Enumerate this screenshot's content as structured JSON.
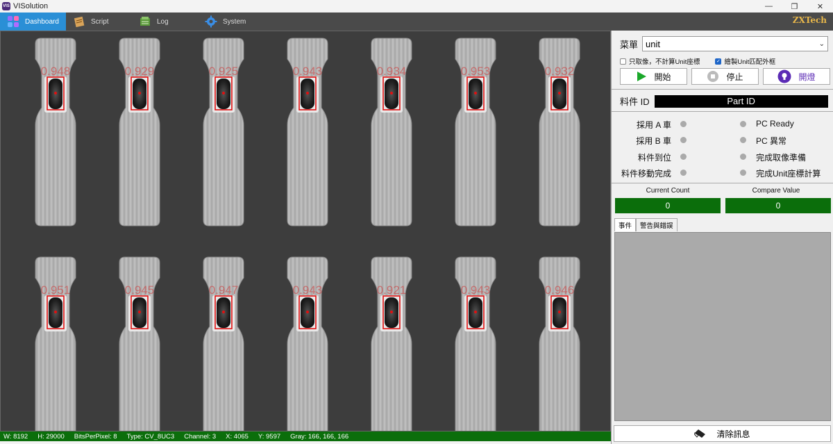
{
  "window": {
    "title": "VISolution",
    "logo_text": "VIS"
  },
  "menubar": {
    "tabs": [
      {
        "label": "Dashboard",
        "icon": "dashboard-icon",
        "active": true
      },
      {
        "label": "Script",
        "icon": "script-icon",
        "active": false
      },
      {
        "label": "Log",
        "icon": "log-icon",
        "active": false
      },
      {
        "label": "System",
        "icon": "gear-icon",
        "active": false
      }
    ],
    "brand": "ZXTech"
  },
  "viewer": {
    "rows": [
      {
        "scores": [
          "0.948",
          "0.929",
          "0.925",
          "0.943",
          "0.934",
          "0.953",
          "0.932"
        ]
      },
      {
        "scores": [
          "0.951",
          "0.945",
          "0.947",
          "0.943",
          "0.921",
          "0.943",
          "0.946"
        ]
      }
    ]
  },
  "statusbar": {
    "w": "W:  8192",
    "h": "H:  29000",
    "bpp": "BitsPerPixel:  8",
    "type": "Type:  CV_8UC3",
    "channel": "Channel:  3",
    "x": "X:  4065",
    "y": "Y:  9597",
    "gray": "Gray:  166, 166, 166"
  },
  "panel": {
    "menu_label": "菜單",
    "menu_value": "unit",
    "check_capture_only": {
      "label": "只取像，不計算Unit座標",
      "checked": false
    },
    "check_draw_box": {
      "label": "繪製Unit匹配外框",
      "checked": true
    },
    "start_label": "開始",
    "stop_label": "停止",
    "light_label": "開燈",
    "partid_label": "料件 ID",
    "partid_value": "Part ID",
    "signals_left": [
      "採用 A 車",
      "採用 B 車",
      "料件到位",
      "料件移動完成"
    ],
    "signals_right": [
      "PC Ready",
      "PC 異常",
      "完成取像準備",
      "完成Unit座標計算"
    ],
    "current_count_label": "Current Count",
    "current_count_value": "0",
    "compare_value_label": "Compare Value",
    "compare_value_value": "0",
    "log_tabs": [
      "事件",
      "警告與錯誤"
    ],
    "clear_label": "清除訊息"
  }
}
